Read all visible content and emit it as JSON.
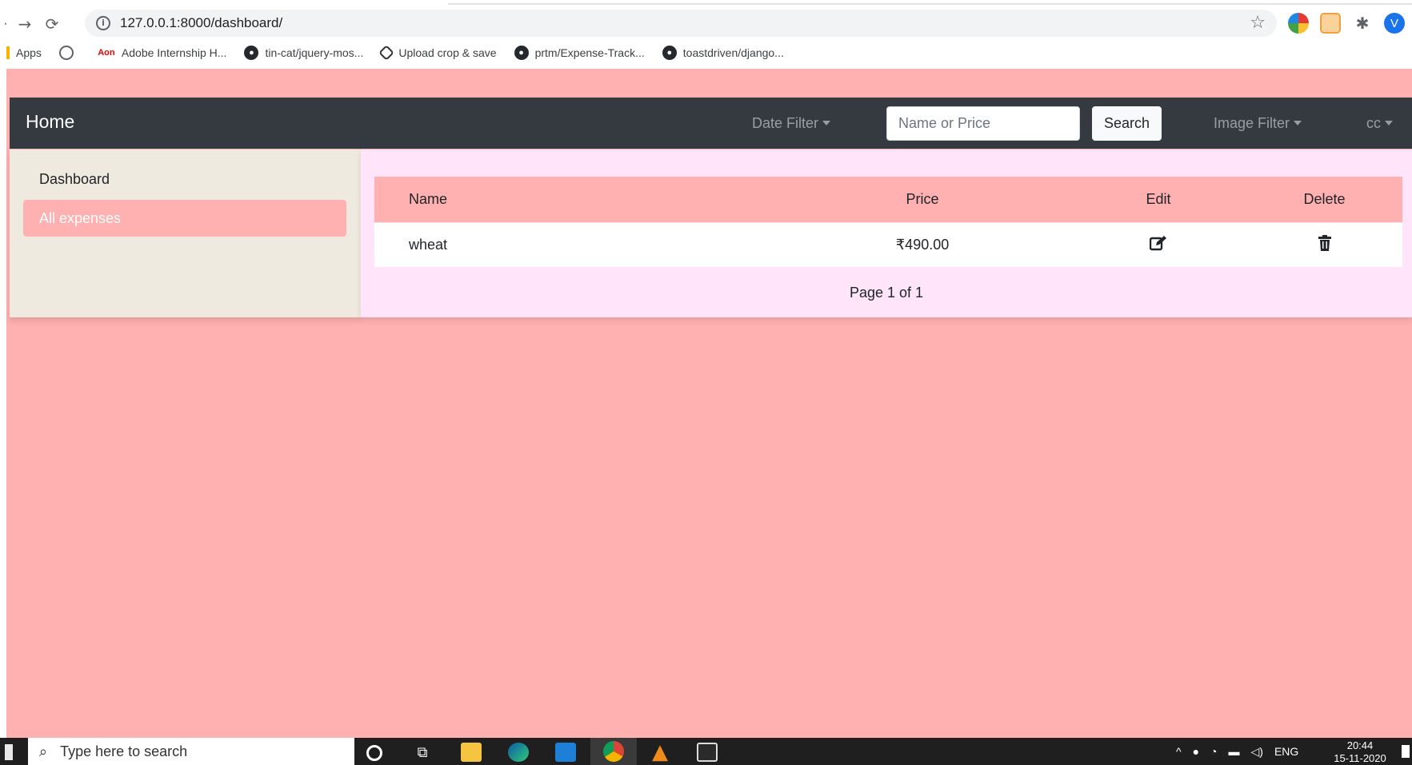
{
  "browser": {
    "url": "127.0.0.1:8000/dashboard/",
    "profile_initial": "V",
    "bookmarks": [
      {
        "label": "Apps",
        "icon": "apps-grid-icon"
      },
      {
        "label": "",
        "icon": "globe-icon"
      },
      {
        "label": "Adobe Internship H...",
        "icon": "adobe-icon",
        "icon_text": "Aon"
      },
      {
        "label": "tin-cat/jquery-mos...",
        "icon": "github-icon"
      },
      {
        "label": "Upload crop & save",
        "icon": "upload-icon"
      },
      {
        "label": "prtm/Expense-Track...",
        "icon": "github-icon"
      },
      {
        "label": "toastdriven/django...",
        "icon": "github-icon"
      }
    ]
  },
  "navbar": {
    "brand": "Home",
    "date_filter_label": "Date Filter",
    "search_placeholder": "Name or Price",
    "search_button": "Search",
    "image_filter_label": "Image Filter",
    "user_label": "cc"
  },
  "sidebar": {
    "items": [
      {
        "label": "Dashboard",
        "active": false
      },
      {
        "label": "All expenses",
        "active": true
      }
    ]
  },
  "table": {
    "headers": [
      "Name",
      "Price",
      "Edit",
      "Delete"
    ],
    "rows": [
      {
        "name": "wheat",
        "price": "₹490.00",
        "edit_icon": "edit-icon",
        "delete_icon": "trash-icon"
      }
    ]
  },
  "pagination": {
    "text": "Page 1 of 1"
  },
  "taskbar": {
    "search_placeholder": "Type here to search",
    "language": "ENG",
    "time": "20:44",
    "date": "15-11-2020"
  },
  "colors": {
    "page_background": "#ffb0b0",
    "navbar": "#343a40",
    "sidebar": "#eeeae0",
    "content": "#ffe4fa",
    "active_item": "#ffb0b0"
  }
}
